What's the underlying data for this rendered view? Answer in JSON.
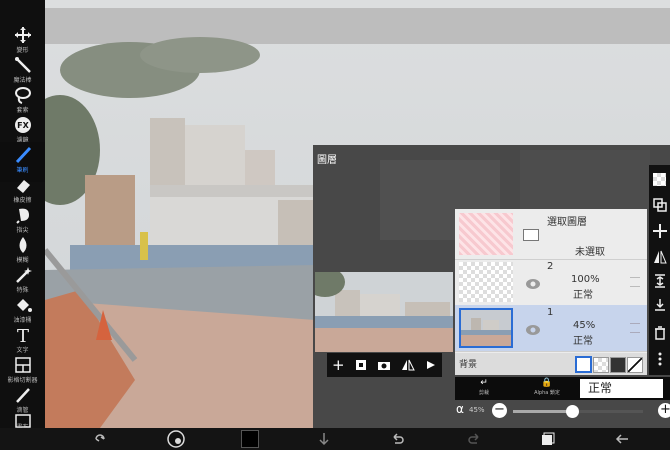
{
  "left_toolbar": {
    "tools": [
      {
        "label": "變形",
        "icon": "move-icon"
      },
      {
        "label": "魔法棒",
        "icon": "magic-wand-icon"
      },
      {
        "label": "套索",
        "icon": "lasso-icon"
      },
      {
        "label": "濾鏡",
        "icon": "fx-icon"
      },
      {
        "label": "筆刷",
        "icon": "brush-icon"
      },
      {
        "label": "橡皮擦",
        "icon": "eraser-icon"
      },
      {
        "label": "指尖",
        "icon": "smudge-icon"
      },
      {
        "label": "模糊",
        "icon": "blur-icon"
      },
      {
        "label": "特殊",
        "icon": "special-icon"
      },
      {
        "label": "油漆桶",
        "icon": "bucket-icon"
      },
      {
        "label": "文字",
        "icon": "text-icon"
      },
      {
        "label": "影格切割器",
        "icon": "frame-divider-icon"
      },
      {
        "label": "滴管",
        "icon": "eyedropper-icon"
      },
      {
        "label": "畫布",
        "icon": "canvas-icon"
      }
    ]
  },
  "layer_panel": {
    "title": "圖層",
    "selection_layer": {
      "title": "選取圖層",
      "status": "未選取"
    },
    "layers": [
      {
        "number": "2",
        "opacity": "100%",
        "blend": "正常"
      },
      {
        "number": "1",
        "opacity": "45%",
        "blend": "正常"
      }
    ],
    "background_label": "背景",
    "clip_label": "剪裁",
    "alpha_lock_label": "Alpha 鎖定",
    "blend_mode": "正常",
    "alpha_symbol": "α",
    "alpha_value": "45%",
    "alpha_fraction": 0.45
  },
  "colors": {
    "accent": "#3a7bd5",
    "toolbar": "#0f0f0f",
    "selected_layer": "#c7d4ec",
    "fill_color": "#000000"
  }
}
